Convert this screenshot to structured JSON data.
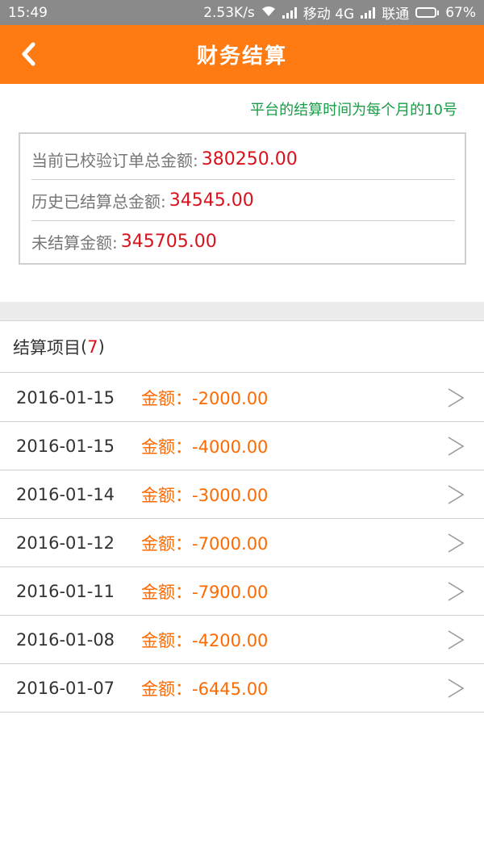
{
  "status_bar": {
    "time": "15:49",
    "speed": "2.53K/s",
    "carrier1": "移动 4G",
    "carrier2": "联通",
    "battery": "67%",
    "battery_level": 0.67
  },
  "header": {
    "title": "财务结算"
  },
  "notice": "平台的结算时间为每个月的10号",
  "summary": {
    "verified_label": "当前已校验订单总金额:",
    "verified_value": "380250.00",
    "settled_label": "历史已结算总金额:",
    "settled_value": "34545.00",
    "unsettled_label": "未结算金额:",
    "unsettled_value": "345705.00"
  },
  "list": {
    "title": "结算项目",
    "open_paren": "(",
    "count": "7",
    "close_paren": ")",
    "items": [
      {
        "date": "2016-01-15",
        "amount": "金额：-2000.00"
      },
      {
        "date": "2016-01-15",
        "amount": "金额：-4000.00"
      },
      {
        "date": "2016-01-14",
        "amount": "金额：-3000.00"
      },
      {
        "date": "2016-01-12",
        "amount": "金额：-7000.00"
      },
      {
        "date": "2016-01-11",
        "amount": "金额：-7900.00"
      },
      {
        "date": "2016-01-08",
        "amount": "金额：-4200.00"
      },
      {
        "date": "2016-01-07",
        "amount": "金额：-6445.00"
      }
    ]
  },
  "colors": {
    "accent": "#fe7a12",
    "value_red": "#d8121c",
    "amount_orange": "#fe6a00",
    "notice_green": "#1b9c48"
  },
  "icons": {
    "back": "chevron-left-icon",
    "row": "chevron-right-icon"
  }
}
